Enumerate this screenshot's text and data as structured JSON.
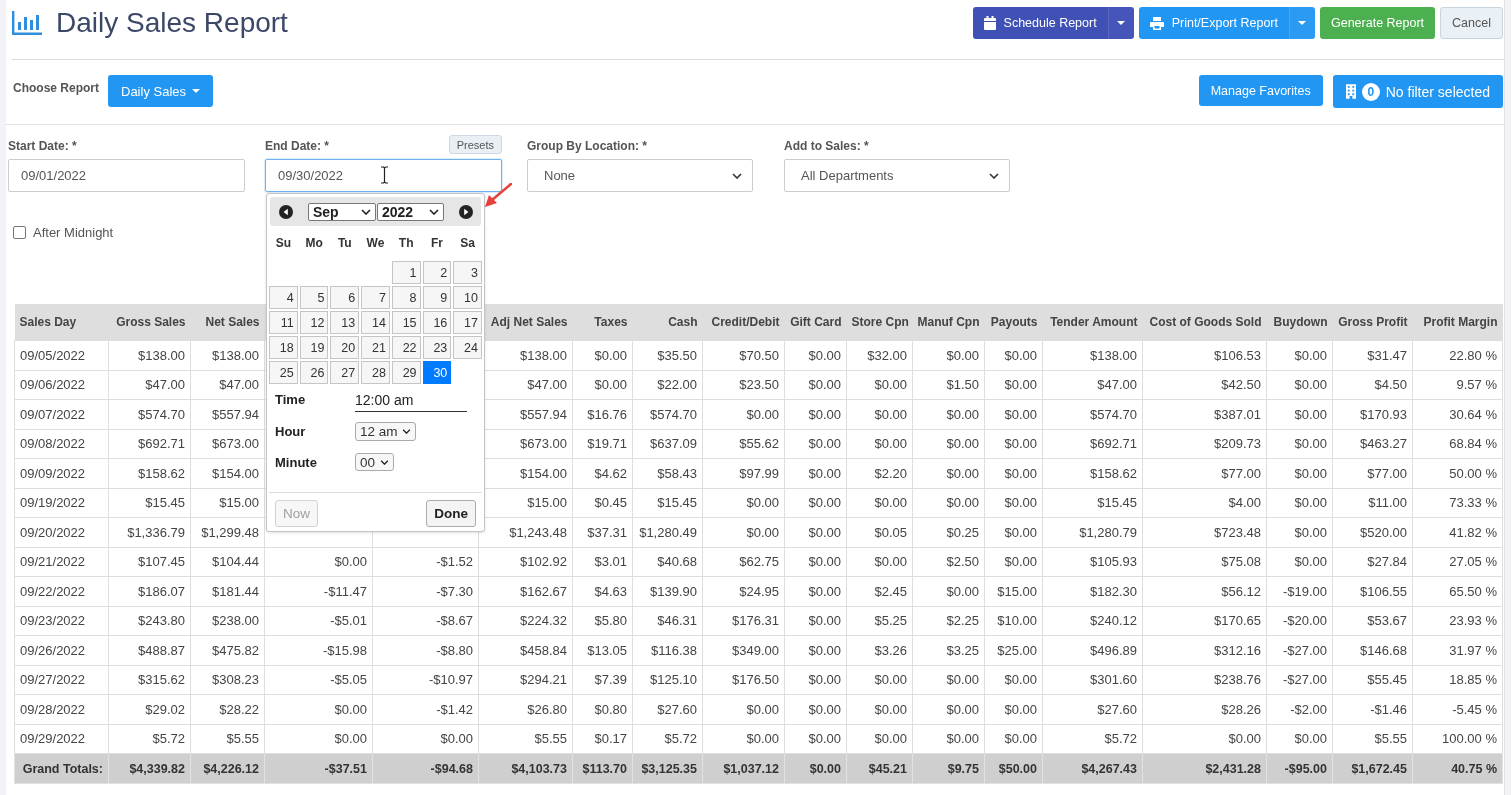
{
  "header": {
    "title": "Daily Sales Report",
    "schedule_button": {
      "label": "Schedule Report"
    },
    "export_button": {
      "label": "Print/Export Report"
    },
    "generate_button": {
      "label": "Generate Report"
    },
    "cancel_button": {
      "label": "Cancel"
    }
  },
  "report_bar": {
    "label": "Choose Report",
    "report_button": {
      "label": "Daily Sales"
    },
    "favorites_button": {
      "label": "Manage Favorites"
    },
    "filter_button": {
      "count": "0",
      "label": "No filter selected"
    }
  },
  "form": {
    "start_date": {
      "label": "Start Date: *",
      "value": "09/01/2022",
      "focused": false
    },
    "end_date": {
      "label": "End Date: *",
      "value": "09/30/2022",
      "focused": true,
      "presets_button": "Presets"
    },
    "group_by_location": {
      "label": "Group By Location: *",
      "value": "None"
    },
    "add_to_sales": {
      "label": "Add to Sales: *",
      "value": "All Departments"
    },
    "after_midnight": {
      "label": "After Midnight",
      "checked": false
    }
  },
  "date_picker": {
    "month": "Sep",
    "year": "2022",
    "weekdays": [
      "Su",
      "Mo",
      "Tu",
      "We",
      "Th",
      "Fr",
      "Sa"
    ],
    "weeks": [
      {
        "kind": "first",
        "days": [
          {
            "label": "1",
            "selected": false
          },
          {
            "label": "2",
            "selected": false
          },
          {
            "label": "3",
            "selected": false
          }
        ]
      },
      {
        "kind": "full",
        "days": [
          {
            "label": "4",
            "selected": false
          },
          {
            "label": "5",
            "selected": false
          },
          {
            "label": "6",
            "selected": false
          },
          {
            "label": "7",
            "selected": false
          },
          {
            "label": "8",
            "selected": false
          },
          {
            "label": "9",
            "selected": false
          },
          {
            "label": "10",
            "selected": false
          }
        ]
      },
      {
        "kind": "full",
        "days": [
          {
            "label": "11",
            "selected": false
          },
          {
            "label": "12",
            "selected": false
          },
          {
            "label": "13",
            "selected": false
          },
          {
            "label": "14",
            "selected": false
          },
          {
            "label": "15",
            "selected": false
          },
          {
            "label": "16",
            "selected": false
          },
          {
            "label": "17",
            "selected": false
          }
        ]
      },
      {
        "kind": "full",
        "days": [
          {
            "label": "18",
            "selected": false
          },
          {
            "label": "19",
            "selected": false
          },
          {
            "label": "20",
            "selected": false
          },
          {
            "label": "21",
            "selected": false
          },
          {
            "label": "22",
            "selected": false
          },
          {
            "label": "23",
            "selected": false
          },
          {
            "label": "24",
            "selected": false
          }
        ]
      },
      {
        "kind": "last",
        "days": [
          {
            "label": "25",
            "selected": false
          },
          {
            "label": "26",
            "selected": false
          },
          {
            "label": "27",
            "selected": false
          },
          {
            "label": "28",
            "selected": false
          },
          {
            "label": "29",
            "selected": false
          },
          {
            "label": "30",
            "selected": true
          }
        ]
      }
    ],
    "time": {
      "label": "Time",
      "value": "12:00 am"
    },
    "hour": {
      "label": "Hour",
      "value": "12 am"
    },
    "minute": {
      "label": "Minute",
      "value": "00"
    },
    "now_button": {
      "label": "Now",
      "disabled": true
    },
    "done_button": {
      "label": "Done"
    }
  },
  "table": {
    "columns": [
      "Sales Day",
      "Gross Sales",
      "Net Sales",
      null,
      null,
      "Adj Net Sales",
      "Taxes",
      "Cash",
      "Credit/Debit",
      "Gift Card",
      "Store Cpn",
      "Manuf Cpn",
      "Payouts",
      "Tender Amount",
      "Cost of Goods Sold",
      "Buydown",
      "Gross Profit",
      "Profit Margin"
    ],
    "rows": [
      [
        "09/05/2022",
        "$138.00",
        "$138.00",
        null,
        null,
        "$138.00",
        "$0.00",
        "$35.50",
        "$70.50",
        "$0.00",
        "$32.00",
        "$0.00",
        "$0.00",
        "$138.00",
        "$106.53",
        "$0.00",
        "$31.47",
        "22.80 %"
      ],
      [
        "09/06/2022",
        "$47.00",
        "$47.00",
        null,
        null,
        "$47.00",
        "$0.00",
        "$22.00",
        "$23.50",
        "$0.00",
        "$0.00",
        "$1.50",
        "$0.00",
        "$47.00",
        "$42.50",
        "$0.00",
        "$4.50",
        "9.57 %"
      ],
      [
        "09/07/2022",
        "$574.70",
        "$557.94",
        null,
        null,
        "$557.94",
        "$16.76",
        "$574.70",
        "$0.00",
        "$0.00",
        "$0.00",
        "$0.00",
        "$0.00",
        "$574.70",
        "$387.01",
        "$0.00",
        "$170.93",
        "30.64 %"
      ],
      [
        "09/08/2022",
        "$692.71",
        "$673.00",
        null,
        null,
        "$673.00",
        "$19.71",
        "$637.09",
        "$55.62",
        "$0.00",
        "$0.00",
        "$0.00",
        "$0.00",
        "$692.71",
        "$209.73",
        "$0.00",
        "$463.27",
        "68.84 %"
      ],
      [
        "09/09/2022",
        "$158.62",
        "$154.00",
        null,
        null,
        "$154.00",
        "$4.62",
        "$58.43",
        "$97.99",
        "$0.00",
        "$2.20",
        "$0.00",
        "$0.00",
        "$158.62",
        "$77.00",
        "$0.00",
        "$77.00",
        "50.00 %"
      ],
      [
        "09/19/2022",
        "$15.45",
        "$15.00",
        null,
        null,
        "$15.00",
        "$0.45",
        "$15.45",
        "$0.00",
        "$0.00",
        "$0.00",
        "$0.00",
        "$0.00",
        "$15.45",
        "$4.00",
        "$0.00",
        "$11.00",
        "73.33 %"
      ],
      [
        "09/20/2022",
        "$1,336.79",
        "$1,299.48",
        null,
        null,
        "$1,243.48",
        "$37.31",
        "$1,280.49",
        "$0.00",
        "$0.00",
        "$0.05",
        "$0.25",
        "$0.00",
        "$1,280.79",
        "$723.48",
        "$0.00",
        "$520.00",
        "41.82 %"
      ],
      [
        "09/21/2022",
        "$107.45",
        "$104.44",
        "$0.00",
        "-$1.52",
        "$102.92",
        "$3.01",
        "$40.68",
        "$62.75",
        "$0.00",
        "$0.00",
        "$2.50",
        "$0.00",
        "$105.93",
        "$75.08",
        "$0.00",
        "$27.84",
        "27.05 %"
      ],
      [
        "09/22/2022",
        "$186.07",
        "$181.44",
        "-$11.47",
        "-$7.30",
        "$162.67",
        "$4.63",
        "$139.90",
        "$24.95",
        "$0.00",
        "$2.45",
        "$0.00",
        "$15.00",
        "$182.30",
        "$56.12",
        "-$19.00",
        "$106.55",
        "65.50 %"
      ],
      [
        "09/23/2022",
        "$243.80",
        "$238.00",
        "-$5.01",
        "-$8.67",
        "$224.32",
        "$5.80",
        "$46.31",
        "$176.31",
        "$0.00",
        "$5.25",
        "$2.25",
        "$10.00",
        "$240.12",
        "$170.65",
        "-$20.00",
        "$53.67",
        "23.93 %"
      ],
      [
        "09/26/2022",
        "$488.87",
        "$475.82",
        "-$15.98",
        "-$8.80",
        "$458.84",
        "$13.05",
        "$116.38",
        "$349.00",
        "$0.00",
        "$3.26",
        "$3.25",
        "$25.00",
        "$496.89",
        "$312.16",
        "-$27.00",
        "$146.68",
        "31.97 %"
      ],
      [
        "09/27/2022",
        "$315.62",
        "$308.23",
        "-$5.05",
        "-$10.97",
        "$294.21",
        "$7.39",
        "$125.10",
        "$176.50",
        "$0.00",
        "$0.00",
        "$0.00",
        "$0.00",
        "$301.60",
        "$238.76",
        "-$27.00",
        "$55.45",
        "18.85 %"
      ],
      [
        "09/28/2022",
        "$29.02",
        "$28.22",
        "$0.00",
        "-$1.42",
        "$26.80",
        "$0.80",
        "$27.60",
        "$0.00",
        "$0.00",
        "$0.00",
        "$0.00",
        "$0.00",
        "$27.60",
        "$28.26",
        "-$2.00",
        "-$1.46",
        "-5.45 %"
      ],
      [
        "09/29/2022",
        "$5.72",
        "$5.55",
        "$0.00",
        "$0.00",
        "$5.55",
        "$0.17",
        "$5.72",
        "$0.00",
        "$0.00",
        "$0.00",
        "$0.00",
        "$0.00",
        "$5.72",
        "$0.00",
        "$0.00",
        "$5.55",
        "100.00 %"
      ]
    ],
    "totals": [
      "Grand Totals:",
      "$4,339.82",
      "$4,226.12",
      "-$37.51",
      "-$94.68",
      "$4,103.73",
      "$113.70",
      "$3,125.35",
      "$1,037.12",
      "$0.00",
      "$45.21",
      "$9.75",
      "$50.00",
      "$4,267.43",
      "$2,431.28",
      "-$95.00",
      "$1,672.45",
      "40.75 %"
    ]
  }
}
